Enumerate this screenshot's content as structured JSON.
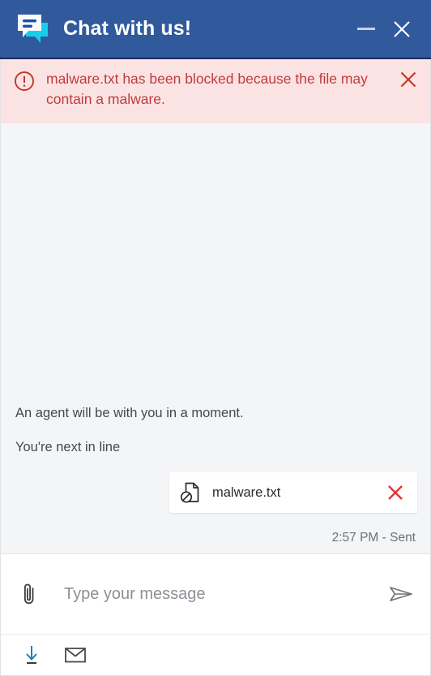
{
  "window": {
    "title": "Chat with us!",
    "logo_icon": "chat-bubbles-icon",
    "minimize_icon": "minimize-icon",
    "close_icon": "close-icon",
    "header_bg": "#305a9c",
    "header_text_color": "#ffffff"
  },
  "banner": {
    "icon": "alert-circle-icon",
    "message": "malware.txt has been blocked because the file may contain a malware.",
    "close_icon": "close-icon",
    "bg": "#fbe3e4",
    "text_color": "#c23b3b"
  },
  "chat": {
    "messages": [
      {
        "text": "An agent will be with you in a moment."
      },
      {
        "text": "You're next in line"
      }
    ],
    "attachment": {
      "icon": "blocked-file-icon",
      "filename": "malware.txt",
      "remove_icon": "close-icon",
      "remove_color": "#e03131"
    },
    "status": "2:57 PM - Sent",
    "background": "#f4f5f7"
  },
  "composer": {
    "attach_icon": "paperclip-icon",
    "placeholder": "Type your message",
    "value": "",
    "send_icon": "send-paper-plane-icon"
  },
  "footer": {
    "buttons": [
      {
        "icon": "download-transcript-icon",
        "color": "#1f7fb5"
      },
      {
        "icon": "email-transcript-icon",
        "color": "#4a4a4a"
      }
    ]
  }
}
